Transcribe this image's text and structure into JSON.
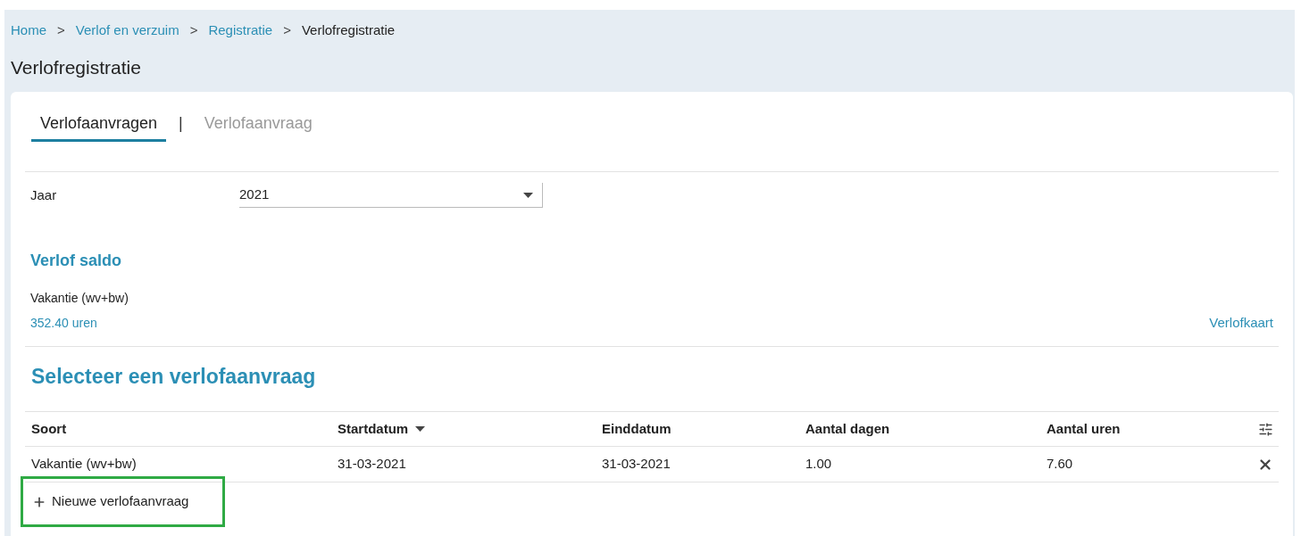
{
  "breadcrumb": [
    {
      "label": "Home",
      "link": true
    },
    {
      "label": "Verlof en verzuim",
      "link": true
    },
    {
      "label": "Registratie",
      "link": true
    },
    {
      "label": "Verlofregistratie",
      "link": false
    }
  ],
  "breadcrumb_separator": ">",
  "page_title": "Verlofregistratie",
  "tabs": [
    {
      "label": "Verlofaanvragen",
      "selected": true
    },
    {
      "label": "Verlofaanvraag",
      "selected": false
    }
  ],
  "tab_separator": "|",
  "year_field": {
    "label": "Jaar",
    "value": "2021"
  },
  "saldo": {
    "title": "Verlof saldo",
    "type": "Vakantie (wv+bw)",
    "amount": "352.40 uren",
    "card_link": "Verlofkaart"
  },
  "table": {
    "title": "Selecteer een verlofaanvraag",
    "columns": [
      {
        "label": "Soort",
        "sorted": false
      },
      {
        "label": "Startdatum",
        "sorted": true
      },
      {
        "label": "Einddatum",
        "sorted": false
      },
      {
        "label": "Aantal dagen",
        "sorted": false
      },
      {
        "label": "Aantal uren",
        "sorted": false
      }
    ],
    "rows": [
      [
        "Vakantie (wv+bw)",
        "31-03-2021",
        "31-03-2021",
        "1.00",
        "7.60"
      ]
    ]
  },
  "new_button": {
    "label": "Nieuwe verlofaanvraag",
    "highlighted": true
  }
}
